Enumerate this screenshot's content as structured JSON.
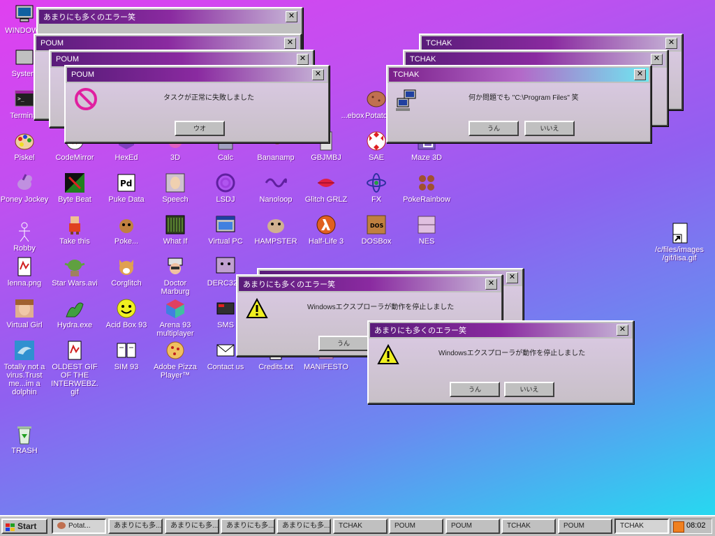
{
  "desktop_icons": [
    {
      "label": "WINDOWS",
      "icon": "computer-icon"
    },
    {
      "label": "System",
      "icon": "system-icon"
    },
    {
      "label": "Terminal",
      "icon": "terminal-icon"
    },
    {
      "label": "Piskel",
      "icon": "palette-icon"
    },
    {
      "label": "CodeMirror",
      "icon": "code-icon"
    },
    {
      "label": "HexEd",
      "icon": "hex-editor-icon"
    },
    {
      "label": "3D",
      "icon": "3d-icon"
    },
    {
      "label": "Calc",
      "icon": "calculator-icon"
    },
    {
      "label": "Bananamp",
      "icon": "banana-icon"
    },
    {
      "label": "GBJMBJ",
      "icon": "gameboy-icon"
    },
    {
      "label": "SAE",
      "icon": "ball-icon"
    },
    {
      "label": "Maze 3D",
      "icon": "maze-icon"
    },
    {
      "label": "Potato",
      "icon": "potato-icon"
    },
    {
      "label": "...ebox",
      "icon": "jukebox-icon"
    },
    {
      "label": "Poney Jockey",
      "icon": "pony-icon"
    },
    {
      "label": "Byte Beat",
      "icon": "bytebeat-icon"
    },
    {
      "label": "Puke Data",
      "icon": "pd-icon"
    },
    {
      "label": "Speech",
      "icon": "speech-icon"
    },
    {
      "label": "LSDJ",
      "icon": "lsdj-icon"
    },
    {
      "label": "Nanoloop",
      "icon": "wave-icon"
    },
    {
      "label": "Glitch GRLZ",
      "icon": "lips-icon"
    },
    {
      "label": "FX",
      "icon": "fx-icon"
    },
    {
      "label": "PokeRainbow",
      "icon": "pokerainbow-icon"
    },
    {
      "label": "Robby",
      "icon": "robot-icon"
    },
    {
      "label": "Take this",
      "icon": "pixel-character-icon"
    },
    {
      "label": "Poke...",
      "icon": "pokemon-icon"
    },
    {
      "label": "What If",
      "icon": "whatif-icon"
    },
    {
      "label": "Virtual PC",
      "icon": "virtual-pc-icon"
    },
    {
      "label": "HAMPSTER",
      "icon": "hamster-icon"
    },
    {
      "label": "Half-Life 3",
      "icon": "half-life-icon"
    },
    {
      "label": "DOSBox",
      "icon": "dosbox-icon"
    },
    {
      "label": "NES",
      "icon": "nes-icon"
    },
    {
      "label": "lenna.png",
      "icon": "image-file-icon"
    },
    {
      "label": "Star Wars.avi",
      "icon": "yoda-icon"
    },
    {
      "label": "Corglitch",
      "icon": "corgi-icon"
    },
    {
      "label": "Doctor Marburg",
      "icon": "doctor-icon"
    },
    {
      "label": "DERC32...",
      "icon": "monitor-face-icon"
    },
    {
      "label": "Virtual Girl",
      "icon": "face-icon"
    },
    {
      "label": "Hydra.exe",
      "icon": "hydra-icon"
    },
    {
      "label": "Acid Box 93",
      "icon": "smiley-icon"
    },
    {
      "label": "Arena 93 multiplayer",
      "icon": "cube-icon"
    },
    {
      "label": "SMS",
      "icon": "sms-icon"
    },
    {
      "label": "Totally not a virus.Trust me...im a dolphin",
      "icon": "dolphin-icon"
    },
    {
      "label": "OLDEST GIF OF THE INTERWEBZ.gif",
      "icon": "gif-file-icon"
    },
    {
      "label": "SIM 93",
      "icon": "book-icon"
    },
    {
      "label": "Adobe Pizza Player™",
      "icon": "pizza-icon"
    },
    {
      "label": "Contact us",
      "icon": "mail-icon"
    },
    {
      "label": "Credits.txt",
      "icon": "text-file-icon"
    },
    {
      "label": "MANIFESTO",
      "icon": "manifesto-icon"
    },
    {
      "label": "TRASH",
      "icon": "trash-icon"
    },
    {
      "label": "/c/files/images/gif/lisa.gif",
      "icon": "shortcut-icon"
    }
  ],
  "dialogs": {
    "err_back": {
      "title": "あまりにも多くのエラー笑"
    },
    "poum1": {
      "title": "POUM"
    },
    "poum2": {
      "title": "POUM"
    },
    "poum3": {
      "title": "POUM",
      "message": "タスクが正常に失敗しました",
      "button": "ウオ"
    },
    "tchak1": {
      "title": "TCHAK"
    },
    "tchak2": {
      "title": "TCHAK"
    },
    "tchak3": {
      "title": "TCHAK",
      "message": "何か問題でも \"C:\\Program Files\" 笑",
      "yes": "うん",
      "no": "いいえ"
    },
    "err_mid": {
      "title": "あまりにも多くのエラー笑",
      "message": "Windowsエクスプローラが動作を停止しました",
      "yes": "うん"
    },
    "err_front": {
      "title": "あまりにも多くのエラー笑",
      "message": "Windowsエクスプローラが動作を停止しました",
      "yes": "うん",
      "no": "いいえ"
    }
  },
  "taskbar": {
    "start": "Start",
    "buttons": [
      "Potat...",
      "あまりにも多...",
      "あまりにも多...",
      "あまりにも多...",
      "あまりにも多...",
      "TCHAK",
      "POUM",
      "POUM",
      "TCHAK",
      "POUM",
      "TCHAK"
    ],
    "clock": "08:02"
  },
  "colors": {
    "title_purple": "#5a1c7a",
    "accent_cyan": "#6ee8f0",
    "window_gray": "#c0c0c0"
  }
}
